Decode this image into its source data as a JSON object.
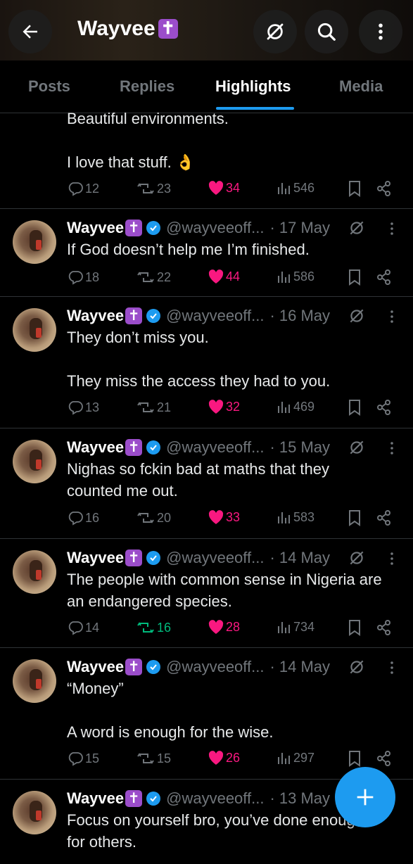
{
  "header": {
    "title": "Wayvee",
    "title_emoji": "✝"
  },
  "tabs": [
    "Posts",
    "Replies",
    "Highlights",
    "Media"
  ],
  "partial_post": {
    "lines": [
      "Beautiful environments.",
      "",
      "I love that stuff. 👌"
    ],
    "replies": "12",
    "reposts": "23",
    "likes": "34",
    "views": "546"
  },
  "posts": [
    {
      "name": "Wayvee",
      "handle": "@wayveeoff...",
      "date": "· 17 May",
      "lines": [
        "If God doesn’t help me I’m finished."
      ],
      "replies": "18",
      "reposts": "22",
      "likes": "44",
      "views": "586"
    },
    {
      "name": "Wayvee",
      "handle": "@wayveeoff...",
      "date": "· 16 May",
      "lines": [
        "They don’t miss you.",
        "",
        "They miss the access they had to you."
      ],
      "replies": "13",
      "reposts": "21",
      "likes": "32",
      "views": "469"
    },
    {
      "name": "Wayvee",
      "handle": "@wayveeoff...",
      "date": "· 15 May",
      "lines": [
        "Nighas so fckin bad at maths that they",
        "counted me out."
      ],
      "replies": "16",
      "reposts": "20",
      "likes": "33",
      "views": "583"
    },
    {
      "name": "Wayvee",
      "handle": "@wayveeoff...",
      "date": "· 14 May",
      "lines": [
        "The people with common sense in Nigeria are",
        "an endangered species."
      ],
      "replies": "14",
      "reposts": "16",
      "likes": "28",
      "views": "734"
    },
    {
      "name": "Wayvee",
      "handle": "@wayveeoff...",
      "date": "· 14 May",
      "lines": [
        "“Money”",
        "",
        "A word is enough for the wise."
      ],
      "replies": "15",
      "reposts": "15",
      "likes": "26",
      "views": "297"
    },
    {
      "name": "Wayvee",
      "handle": "@wayveeoff...",
      "date": "· 13 May",
      "lines": [
        "Focus on yourself bro, you’ve done enough",
        "for others."
      ]
    }
  ]
}
